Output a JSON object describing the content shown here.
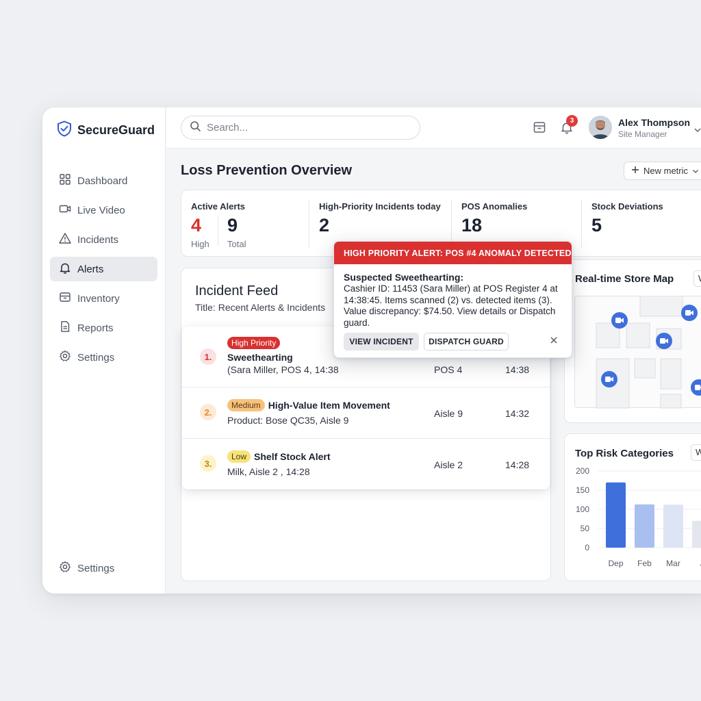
{
  "brand": {
    "name": "SecureGuard"
  },
  "sidebar": {
    "items": [
      {
        "label": "Dashboard",
        "icon": "grid-icon"
      },
      {
        "label": "Live Video",
        "icon": "video-icon"
      },
      {
        "label": "Incidents",
        "icon": "warning-icon"
      },
      {
        "label": "Alerts",
        "icon": "bell-icon"
      },
      {
        "label": "Inventory",
        "icon": "box-icon"
      },
      {
        "label": "Reports",
        "icon": "document-icon"
      },
      {
        "label": "Settings",
        "icon": "gear-icon"
      }
    ],
    "active_index": 3,
    "bottom_settings": "Settings"
  },
  "topbar": {
    "search_placeholder": "Search...",
    "notification_count": "3",
    "user_name": "Alex Thompson",
    "user_role": "Site Manager"
  },
  "page": {
    "title": "Loss Prevention Overview",
    "new_metric_label": "New metric"
  },
  "stats": {
    "active_alerts": {
      "label": "Active Alerts",
      "high_value": "4",
      "high_label": "High",
      "total_value": "9",
      "total_label": "Total"
    },
    "high_priority": {
      "label": "High-Priority Incidents today",
      "value": "2"
    },
    "pos_anomalies": {
      "label": "POS Anomalies",
      "value": "18"
    },
    "stock_deviations": {
      "label": "Stock Deviations",
      "value": "5"
    }
  },
  "feed": {
    "title": "Incident Feed",
    "subtitle": "Title: Recent Alerts & Incidents",
    "rows": [
      {
        "num": "1.",
        "badge": "High Priority",
        "title": "Sweethearting",
        "detail": "(Sara Miller, POS 4, 14:38",
        "location": "POS 4",
        "time": "14:38"
      },
      {
        "num": "2.",
        "badge": "Medium",
        "title": "High-Value Item Movement",
        "detail": "Product: Bose QC35, Aisle 9",
        "location": "Aisle 9",
        "time": "14:32"
      },
      {
        "num": "3.",
        "badge": "Low",
        "title": "Shelf Stock Alert",
        "detail": "Milk, Aisle 2 , 14:28",
        "location": "Aisle 2",
        "time": "14:28"
      }
    ]
  },
  "alert": {
    "header": "HIGH PRIORITY ALERT: POS #4 ANOMALY DETECTED",
    "title": "Suspected Sweethearting:",
    "body": "Cashier ID: 11453 (Sara Miller) at POS Register 4 at 14:38:45. Items scanned (2) vs. detected items (3). Value discrepancy: $74.50. View details or Dispatch guard.",
    "view_label": "VIEW INCIDENT",
    "dispatch_label": "DISPATCH GUARD"
  },
  "map": {
    "title": "Real-time Store Map",
    "select_value": "W"
  },
  "risk": {
    "title": "Top Risk Categories",
    "select_value": "W"
  },
  "chart_data": {
    "type": "bar",
    "categories": [
      "Dep",
      "Feb",
      "Mar",
      "J"
    ],
    "values": [
      170,
      113,
      112,
      70
    ],
    "ylim": [
      0,
      200
    ],
    "yticks": [
      0,
      50,
      100,
      150,
      200
    ],
    "colors": [
      "#3f6fdb",
      "#a9bff0",
      "#dde4f4",
      "#e3e6ec"
    ]
  },
  "colors": {
    "alert_red": "#d93030",
    "accent_blue": "#3f6fdb"
  }
}
